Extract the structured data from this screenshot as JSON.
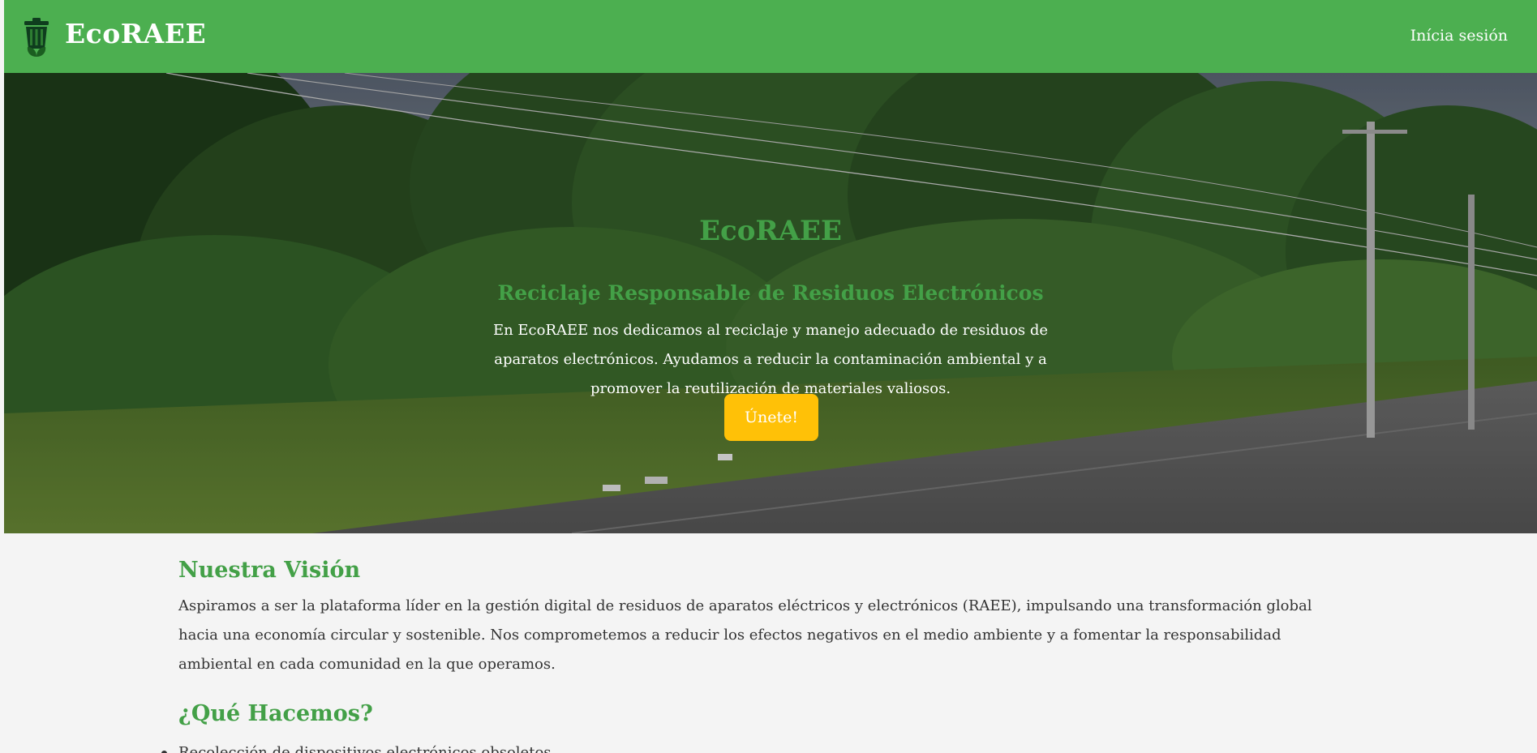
{
  "header": {
    "brand": "EcoRAEE",
    "login_label": "Inícia sesión"
  },
  "hero": {
    "title": "EcoRAEE",
    "subtitle": "Reciclaje Responsable de Residuos Electrónicos",
    "description": "En EcoRAEE nos dedicamos al reciclaje y manejo adecuado de residuos de aparatos electrónicos. Ayudamos a reducir la contaminación ambiental y a promover la reutilización de materiales valiosos.",
    "cta_label": "Únete!"
  },
  "vision": {
    "title": "Nuestra Visión",
    "text": "Aspiramos a ser la plataforma líder en la gestión digital de residuos de aparatos eléctricos y electrónicos (RAEE), impulsando una transformación global hacia una economía circular y sostenible. Nos comprometemos a reducir los efectos negativos en el medio ambiente y a fomentar la responsabilidad ambiental en cada comunidad en la que operamos."
  },
  "what_we_do": {
    "title": "¿Qué Hacemos?",
    "items": [
      "Recolección de dispositivos electrónicos obsoletos"
    ]
  },
  "colors": {
    "brand_green": "#4caf50",
    "title_green": "#43a047",
    "cta_yellow": "#ffc107",
    "background": "#f4f4f4"
  },
  "icons": {
    "logo": "recycle-bin-leaf-icon"
  }
}
